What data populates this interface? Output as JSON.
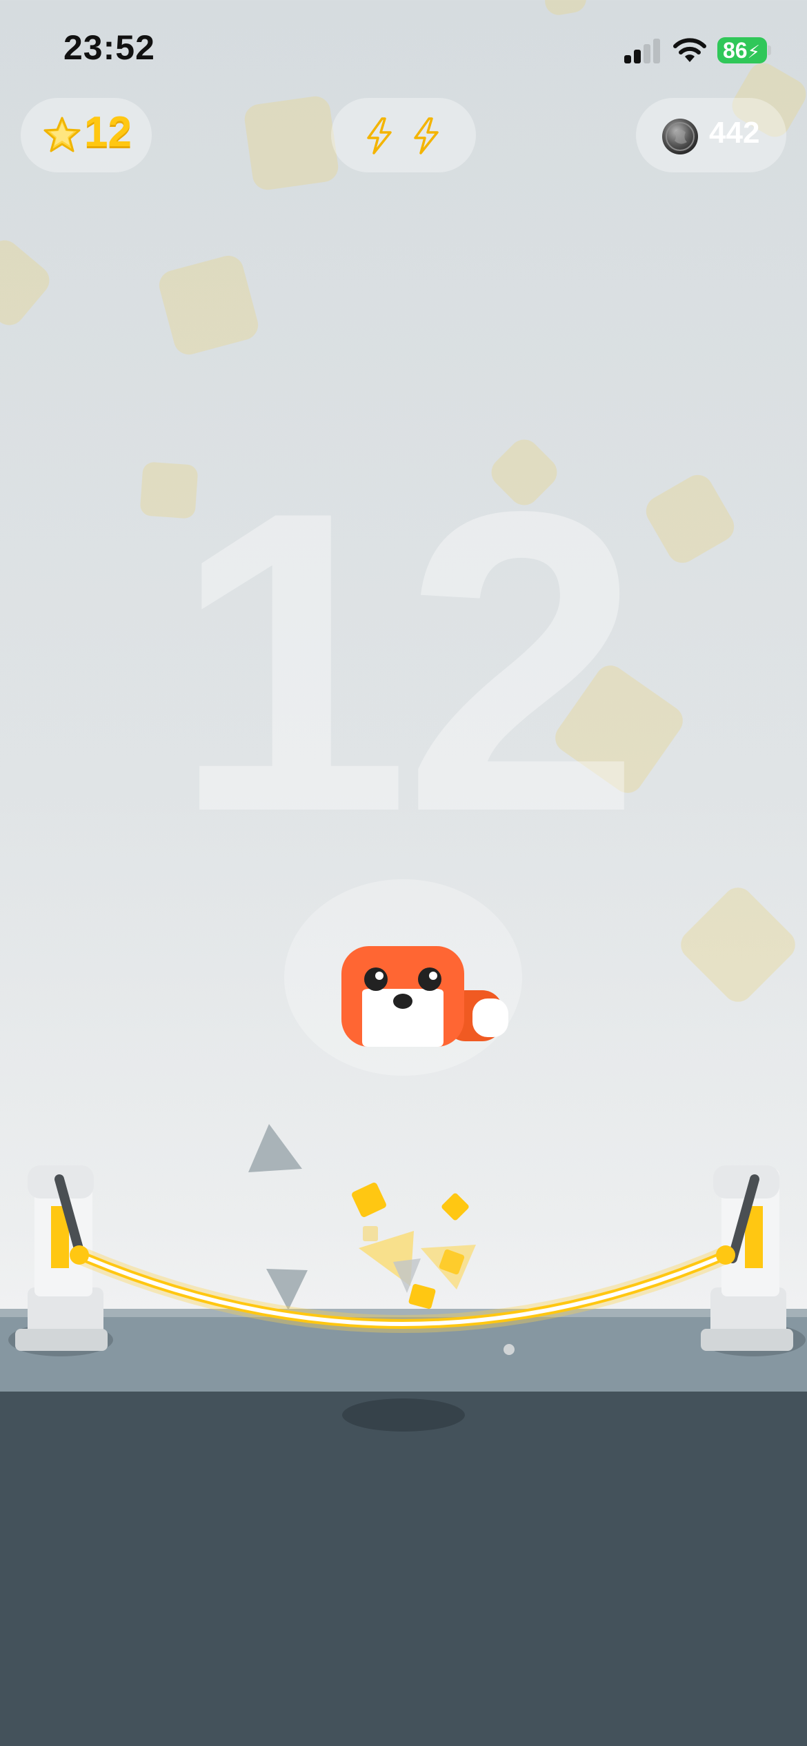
{
  "status_bar": {
    "time": "23:52",
    "battery_level": "86",
    "signal_bars": 2,
    "icons": [
      "signal-icon",
      "wifi-icon",
      "battery-charging-icon"
    ]
  },
  "hud": {
    "score": "12",
    "power_charges": 2,
    "coins": "442",
    "icons": [
      "star-icon",
      "lightning-icon",
      "coin-icon"
    ]
  },
  "background_score": "12",
  "character": {
    "name": "fox",
    "icon": "fox-character"
  },
  "colors": {
    "accent_yellow": "#ffc712",
    "fox_orange": "#ff6633",
    "platform": "#8697a1",
    "ground": "#44525b",
    "battery": "#30c759"
  }
}
